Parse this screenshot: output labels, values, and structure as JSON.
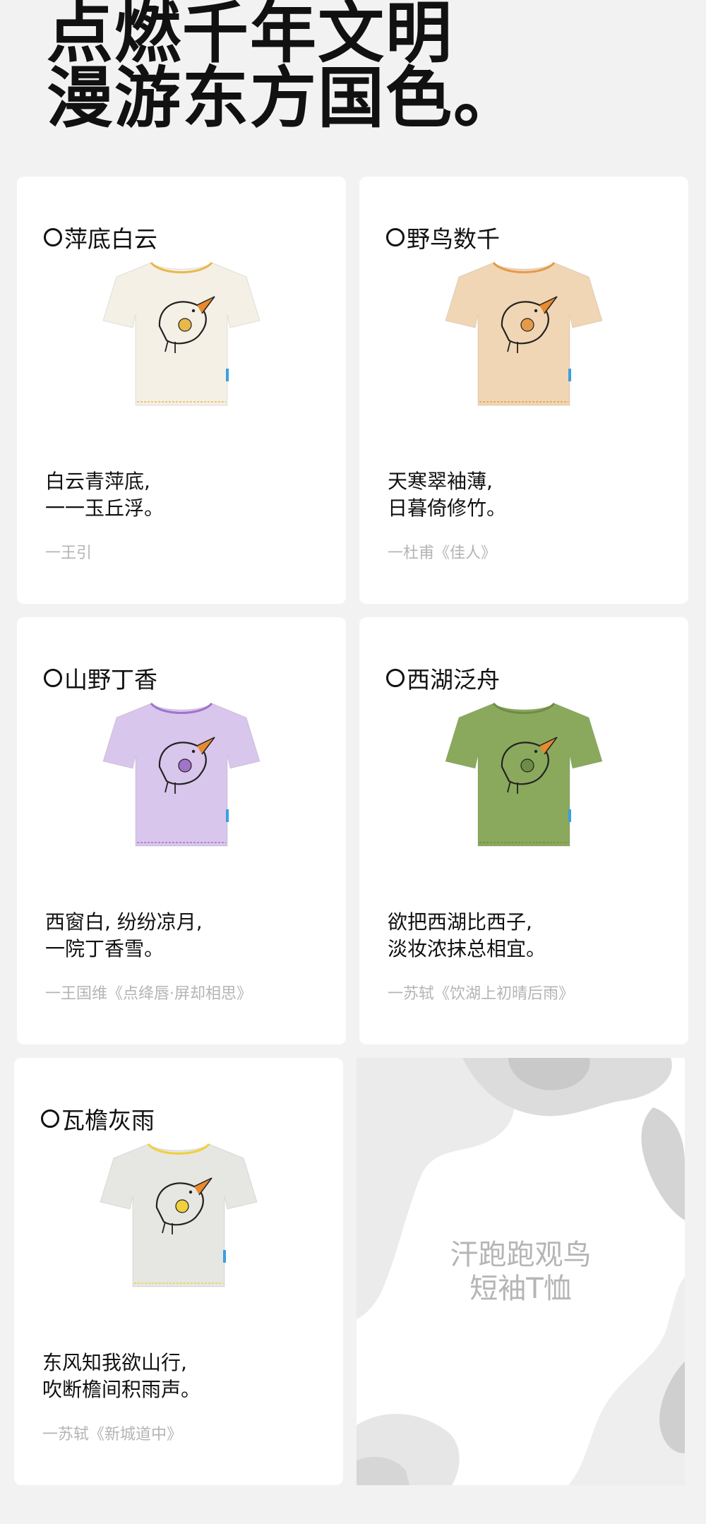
{
  "hero": {
    "line1": "点燃千年文明",
    "line2": "漫游东方国色。"
  },
  "cards": [
    {
      "title": "萍底白云",
      "poem": [
        "白云青萍底,",
        "一一玉丘浮。"
      ],
      "credit": "一王引",
      "shirt_color": "#f4f0e6",
      "trim_color": "#e8b84c",
      "print_icon": "kingfisher-print-icon"
    },
    {
      "title": "野鸟数千",
      "poem": [
        "天寒翠袖薄,",
        "日暮倚修竹。"
      ],
      "credit": "一杜甫《佳人》",
      "shirt_color": "#f0d6b4",
      "trim_color": "#e59a4a",
      "print_icon": "woodpecker-print-icon"
    },
    {
      "title": "山野丁香",
      "poem": [
        "西窗白, 纷纷凉月,",
        "一院丁香雪。"
      ],
      "credit": "一王国维《点绛唇·屏却相思》",
      "shirt_color": "#d9c6ec",
      "trim_color": "#a074c9",
      "print_icon": "bird-print-icon"
    },
    {
      "title": "西湖泛舟",
      "poem": [
        "欲把西湖比西子,",
        "淡妆浓抹总相宜。"
      ],
      "credit": "一苏轼《饮湖上初晴后雨》",
      "shirt_color": "#8aa95d",
      "trim_color": "#6e8c45",
      "print_icon": "bird-print-icon"
    },
    {
      "title": "瓦檐灰雨",
      "poem": [
        "东风知我欲山行,",
        "吹断檐间积雨声。"
      ],
      "credit": "一苏轼《新城道中》",
      "shirt_color": "#e6e6e3",
      "trim_color": "#f2cf3c",
      "print_icon": "bird-print-icon"
    }
  ],
  "promo": {
    "line1": "汗跑跑观鸟",
    "line2": "短袖T恤"
  }
}
